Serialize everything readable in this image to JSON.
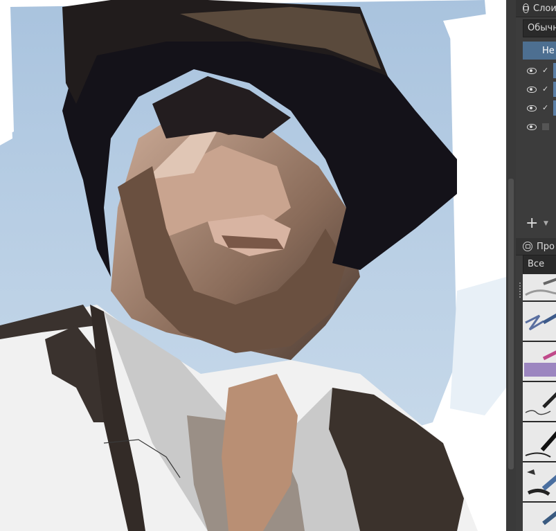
{
  "layers_panel": {
    "title": "Слои",
    "blend_mode": "Обычный",
    "active_layer_label": "Не",
    "layers": [
      {
        "visible": true,
        "checked": true
      },
      {
        "visible": true,
        "checked": true
      },
      {
        "visible": true,
        "checked": true
      },
      {
        "visible": true,
        "checked": false
      }
    ],
    "add_label": "+"
  },
  "presets_panel": {
    "title": "Про",
    "filter_value": "Все",
    "brushes": [
      "pencil-brush",
      "blue-pencil-brush",
      "colored-pencil-brush",
      "ink-pen-brush",
      "fountain-pen-brush",
      "marker-brush",
      "pen-brush"
    ]
  },
  "colors": {
    "panel_bg": "#3c3c3c",
    "active_layer": "#4d6f91",
    "sky": "#b5cde3"
  }
}
